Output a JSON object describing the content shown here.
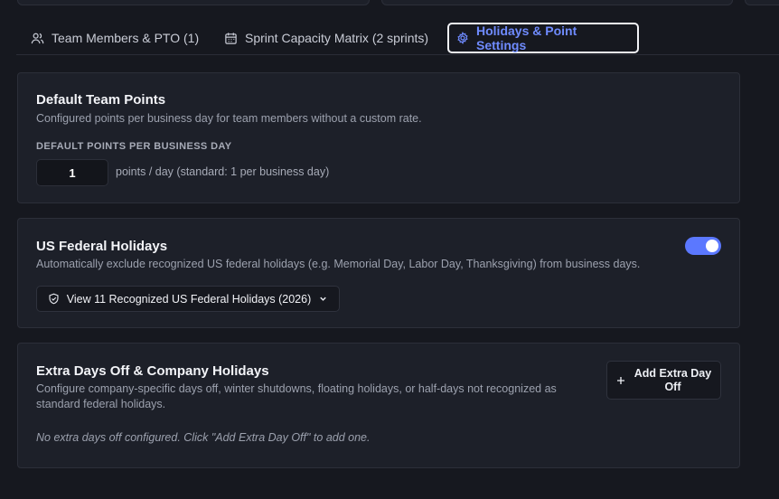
{
  "tabs": [
    {
      "label": "Team Members & PTO (1)",
      "icon": "users-icon"
    },
    {
      "label": "Sprint Capacity Matrix (2 sprints)",
      "icon": "calendar-icon"
    },
    {
      "label": "Holidays & Point Settings",
      "icon": "gear-icon",
      "active": true
    }
  ],
  "default_points": {
    "title": "Default Team Points",
    "description": "Configured points per business day for team members without a custom rate.",
    "field_label": "DEFAULT POINTS PER BUSINESS DAY",
    "value": "1",
    "hint": "points / day (standard: 1 per business day)"
  },
  "federal_holidays": {
    "title": "US Federal Holidays",
    "description": "Automatically exclude recognized US federal holidays (e.g. Memorial Day, Labor Day, Thanksgiving) from business days.",
    "enabled": true,
    "view_button": "View 11 Recognized US Federal Holidays (2026)"
  },
  "extra_days": {
    "title": "Extra Days Off & Company Holidays",
    "description_line1": "Configure company-specific days off, winter shutdowns, floating holidays, or half-days not recognized as",
    "description_line2": "standard federal holidays.",
    "add_button_line1": "Add Extra Day",
    "add_button_line2": "Off",
    "empty_text": "No extra days off configured. Click \"Add Extra Day Off\" to add one."
  },
  "colors": {
    "accent": "#5b78ff",
    "active_tab_text": "#6f8bff",
    "background": "#16181f",
    "card": "#1d2029"
  }
}
